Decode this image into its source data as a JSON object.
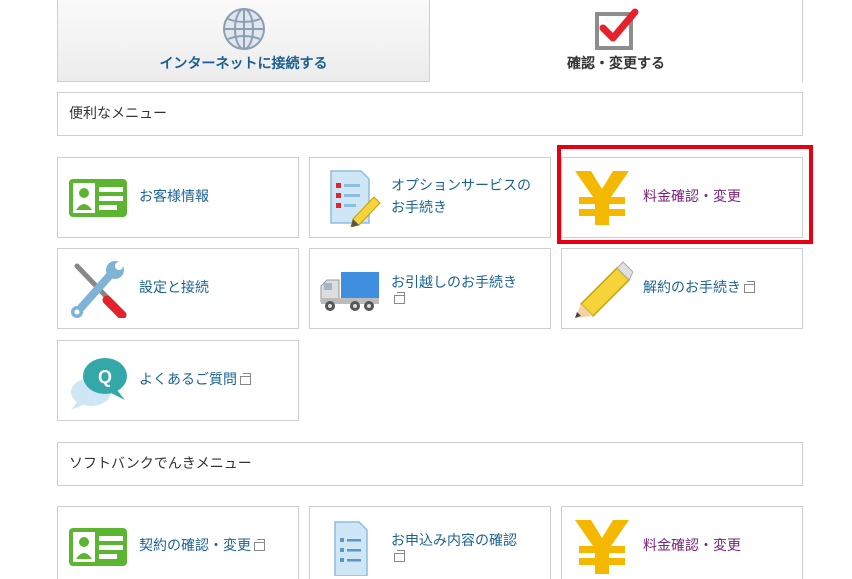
{
  "tabs": {
    "internet": {
      "label": "インターネットに接続する",
      "icon": "globe-icon"
    },
    "confirm": {
      "label": "確認・変更する",
      "icon": "checkbox-icon"
    }
  },
  "sections": [
    {
      "title": "便利なメニュー"
    },
    {
      "title": "ソフトバンクでんきメニュー"
    }
  ],
  "menu": [
    {
      "label": "お客様情報",
      "icon": "id-card-icon",
      "external": false
    },
    {
      "label1": "オプションサービスの",
      "label2": "お手続き",
      "icon": "checklist-pencil-icon",
      "external": false
    },
    {
      "label": "料金確認・変更",
      "icon": "yen-icon",
      "external": false,
      "highlighted": true
    },
    {
      "label": "設定と接続",
      "icon": "tools-icon",
      "external": false
    },
    {
      "label": "お引越しのお手続き",
      "icon": "moving-truck-icon",
      "external": true
    },
    {
      "label": "解約のお手続き",
      "icon": "pencil-icon",
      "external": true
    },
    {
      "label": "よくあるご質問",
      "icon": "faq-bubble-icon",
      "external": true
    }
  ],
  "denki_menu": [
    {
      "label": "契約の確認・変更",
      "icon": "id-card-icon",
      "external": true
    },
    {
      "label": "お申込み内容の確認",
      "icon": "document-icon",
      "external": true
    },
    {
      "label": "料金確認・変更",
      "icon": "yen-icon",
      "external": false
    }
  ],
  "colors": {
    "link": "#1a6496",
    "visited": "#7a1f7a",
    "highlight": "#e60012",
    "yen": "#f5b800",
    "card_green": "#5cb531"
  }
}
